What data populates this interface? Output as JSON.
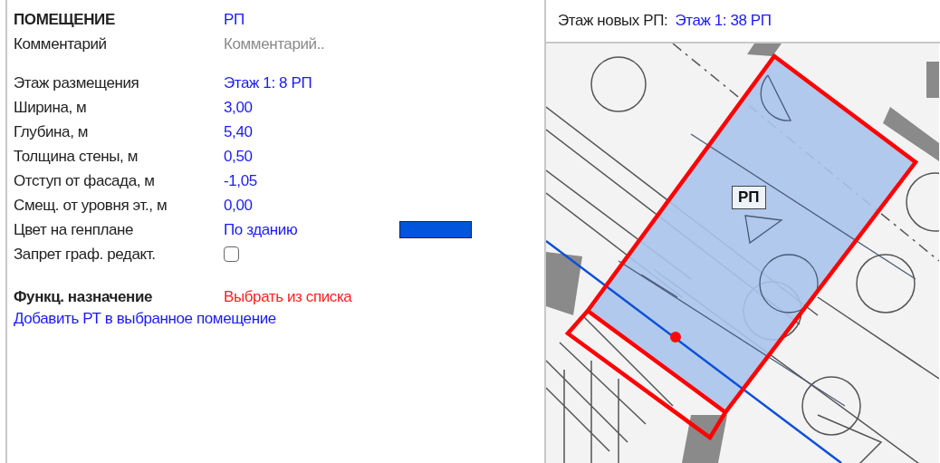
{
  "room": {
    "title": "ПОМЕЩЕНИЕ",
    "name": "РП"
  },
  "comment": {
    "label": "Комментарий",
    "placeholder": "Комментарий.."
  },
  "properties": [
    {
      "label": "Этаж размещения",
      "value": "Этаж 1: 8 РП"
    },
    {
      "label": "Ширина, м",
      "value": "3,00"
    },
    {
      "label": "Глубина, м",
      "value": "5,40"
    },
    {
      "label": "Толщина стены, м",
      "value": "0,50"
    },
    {
      "label": "Отступ от фасада, м",
      "value": "-1,05"
    },
    {
      "label": "Смещ. от уровня эт., м",
      "value": "0,00"
    }
  ],
  "color_row": {
    "label": "Цвет на генплане",
    "value": "По зданию",
    "color": "#0055dd"
  },
  "lock_row": {
    "label": "Запрет граф. редакт.",
    "checked": false
  },
  "function": {
    "label": "Функц. назначение",
    "value": "Выбрать из списка"
  },
  "add_link": "Добавить РТ в выбранное помещение",
  "plan": {
    "floor_label": "Этаж новых РП:",
    "floor_value": "Этаж 1: 38 РП",
    "room_label": "РП"
  }
}
